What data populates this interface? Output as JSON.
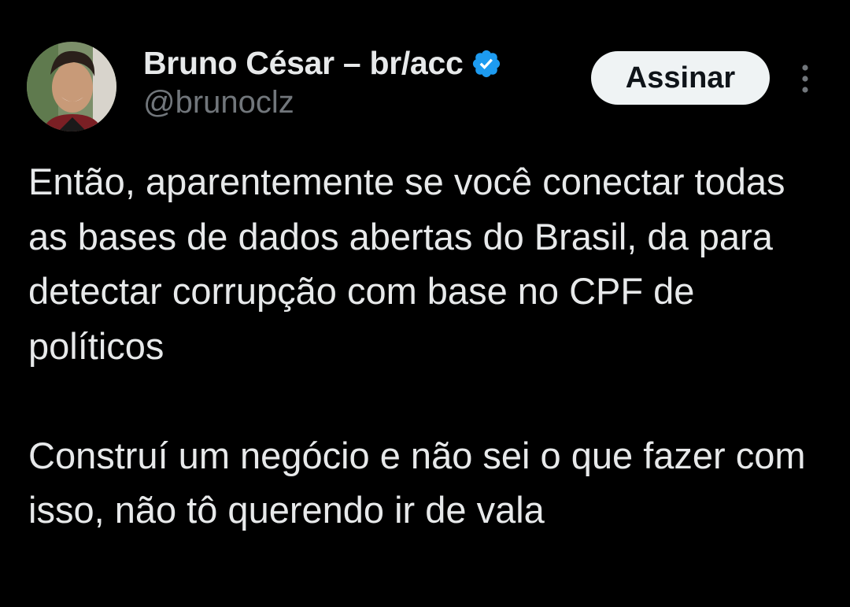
{
  "author": {
    "display_name": "Bruno César – br/acc",
    "handle": "@brunoclz",
    "verified": true,
    "verified_color": "#1d9bf0"
  },
  "actions": {
    "subscribe_label": "Assinar",
    "more_icon": "more-vertical-icon"
  },
  "tweet": {
    "paragraphs": [
      "Então, aparentemente se você conectar todas as bases de dados abertas do Brasil, da para detectar corrupção com base no CPF de políticos",
      "Construí um negócio e não sei o que fazer com isso, não tô querendo ir de vala"
    ]
  },
  "colors": {
    "background": "#000000",
    "text_primary": "#e7e9ea",
    "text_secondary": "#71767b",
    "button_bg": "#eff3f4",
    "button_text": "#0f1419"
  }
}
